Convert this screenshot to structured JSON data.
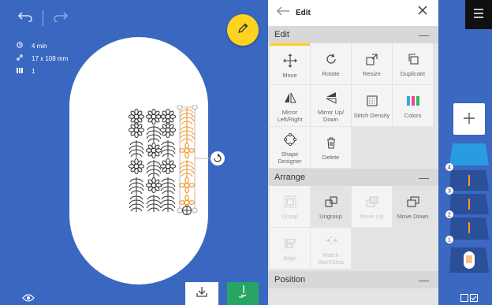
{
  "canvas": {
    "info": [
      {
        "icon": "clock-icon",
        "text": "4 min"
      },
      {
        "icon": "resize-arrow-icon",
        "text": "17 x 108 mm"
      },
      {
        "icon": "color-bars-icon",
        "text": "1"
      }
    ],
    "colors": {
      "hoop": "#ffffff",
      "background": "#3a68c1",
      "accent": "#ffd21f",
      "selection": "#f5962e",
      "sew_button": "#27a564"
    }
  },
  "panel": {
    "title": "Edit",
    "sections": {
      "edit": "Edit",
      "arrange": "Arrange",
      "position": "Position"
    },
    "edit_tools": [
      {
        "label": "Move"
      },
      {
        "label": "Rotate"
      },
      {
        "label": "Resize"
      },
      {
        "label": "Duplicate"
      },
      {
        "label": "Mirror Left/Right"
      },
      {
        "label": "Mirror Up/ Down"
      },
      {
        "label": "Stitch Density"
      },
      {
        "label": "Colors"
      },
      {
        "label": "Shape Designer"
      },
      {
        "label": "Delete"
      }
    ],
    "arrange_tools": [
      {
        "label": "Group"
      },
      {
        "label": "Ungroup"
      },
      {
        "label": "Move Up"
      },
      {
        "label": "Move Down"
      },
      {
        "label": "Align"
      },
      {
        "label": "Match Start/Stop"
      }
    ]
  },
  "layers": [
    {
      "badge": "4"
    },
    {
      "badge": "3"
    },
    {
      "badge": "2"
    },
    {
      "badge": "1"
    }
  ]
}
